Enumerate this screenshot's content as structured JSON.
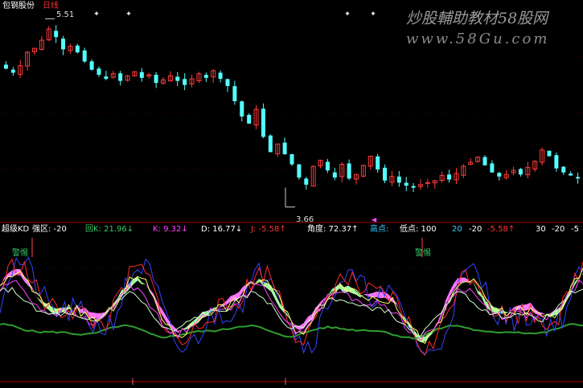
{
  "header": {
    "stock_name": "包钢股份",
    "period": "日线"
  },
  "watermark": {
    "line1": "炒股輔助教材58股网",
    "line2": "www.58Gu.com"
  },
  "colors": {
    "background": "#000000",
    "up": "#ff3b3b",
    "down": "#54ffff",
    "label_white": "#ffffff",
    "label_red": "#ff3333",
    "label_green": "#33cc66",
    "label_yellow": "#ffff66",
    "label_magenta": "#ff44ff",
    "separator": "#9b0000"
  },
  "chart_data": [
    {
      "type": "candlestick",
      "title": "",
      "high_marker": "5.51",
      "low_marker": "3.66",
      "ylim": [
        3.5,
        5.6
      ],
      "note": "approximate daily closes read off the price panel",
      "series": [
        {
          "values": [
            5.02,
            4.98,
            5.05,
            5.18,
            5.22,
            5.3,
            5.41,
            5.33,
            5.21,
            5.24,
            5.18,
            5.09,
            5.01,
            4.96,
            4.92,
            4.97,
            4.9,
            4.95,
            4.99,
            4.93,
            4.96,
            4.88,
            4.91,
            4.95,
            4.9,
            4.86,
            4.92,
            4.97,
            4.93,
            5.0,
            4.92,
            4.85,
            4.7,
            4.55,
            4.48,
            4.62,
            4.35,
            4.2,
            4.28,
            4.18,
            4.08,
            3.95,
            3.88,
            4.06,
            4.12,
            4.02,
            3.95,
            4.08,
            3.94,
            3.98,
            4.07,
            4.16,
            4.03,
            3.92,
            3.96,
            3.9,
            3.87,
            3.85,
            3.88,
            3.9,
            3.92,
            3.97,
            3.93,
            3.99,
            4.06,
            4.1,
            4.15,
            4.07,
            4.0,
            3.96,
            3.98,
            4.02,
            3.98,
            4.05,
            4.11,
            4.22,
            4.16,
            4.04,
            4.0,
            3.97,
            3.94
          ]
        }
      ]
    },
    {
      "type": "line",
      "title": "超级KD",
      "legend": [
        {
          "label": "强区:",
          "value": "-20",
          "arrow": ""
        },
        {
          "label": "回K:",
          "value": "21.96",
          "arrow": "↓"
        },
        {
          "label": "K:",
          "value": "9.32",
          "arrow": "↓"
        },
        {
          "label": "D:",
          "value": "16.77",
          "arrow": "↓"
        },
        {
          "label": "J:",
          "value": "-5.58",
          "arrow": "↑"
        },
        {
          "label": "角度:",
          "value": "72.37",
          "arrow": "↑"
        },
        {
          "label": "高点:",
          "value": "",
          "arrow": ""
        },
        {
          "label": "低点:",
          "value": "100",
          "arrow": ""
        },
        {
          "label": "",
          "value": "20",
          "arrow": ""
        },
        {
          "label": "",
          "value": "-20",
          "arrow": ""
        },
        {
          "label": "",
          "value": "-5.58",
          "arrow": "↑"
        },
        {
          "label": "",
          "value": "30",
          "arrow": ""
        },
        {
          "label": "",
          "value": "-20",
          "arrow": ""
        },
        {
          "label": "",
          "value": "-5",
          "arrow": ""
        }
      ],
      "alert_label": "警惕",
      "ylim": [
        -25,
        110
      ]
    }
  ]
}
